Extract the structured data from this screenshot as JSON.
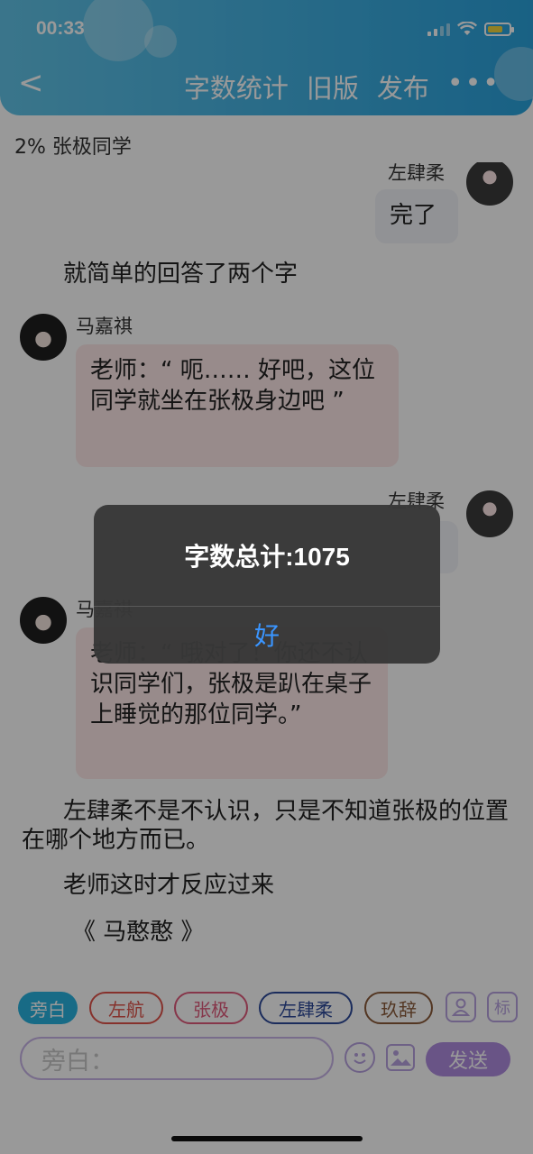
{
  "status_bar": {
    "time": "00:33"
  },
  "nav": {
    "back_glyph": "<",
    "word_count": "字数统计",
    "old_version": "旧版",
    "publish": "发布",
    "more": "•••"
  },
  "story_progress": "2% 张极同学",
  "chat": {
    "msg1": {
      "speaker": "左肆柔",
      "text": "完了"
    },
    "narration1": "就简单的回答了两个字",
    "msg2": {
      "speaker": "马嘉祺",
      "text": "老师：“ 呃…… 好吧，这位同学就坐在张极身边吧 ”"
    },
    "msg3": {
      "speaker": "左肆柔"
    },
    "msg4": {
      "speaker": "马嘉祺",
      "text": "老师：“ 哦对了！你还不认识同学们，张极是趴在桌子上睡觉的那位同学。”"
    },
    "narration2": "左肆柔不是不认识，只是不知道张极的位置在哪个地方而已。",
    "narration3": "老师这时才反应过来",
    "narration4": "《 马憨憨 》"
  },
  "composer": {
    "chips": [
      "旁白",
      "左航",
      "张极",
      "左肆柔",
      "玖辞"
    ],
    "mark_label": "标",
    "input_placeholder": "旁白：",
    "send_label": "发送"
  },
  "alert": {
    "message": "字数总计:1075",
    "ok_label": "好"
  },
  "colors": {
    "header_start": "#62c4e8",
    "header_end": "#2aa2dd",
    "chip_narration": "#29b3e0",
    "chip_zuohang": "#e0534a",
    "chip_zhangji": "#e05a7c",
    "chip_zuosirou": "#2d4a9a",
    "chip_jiuci": "#8a5a3a",
    "send_bg": "#b08de0",
    "alert_ok": "#3a95ff"
  }
}
